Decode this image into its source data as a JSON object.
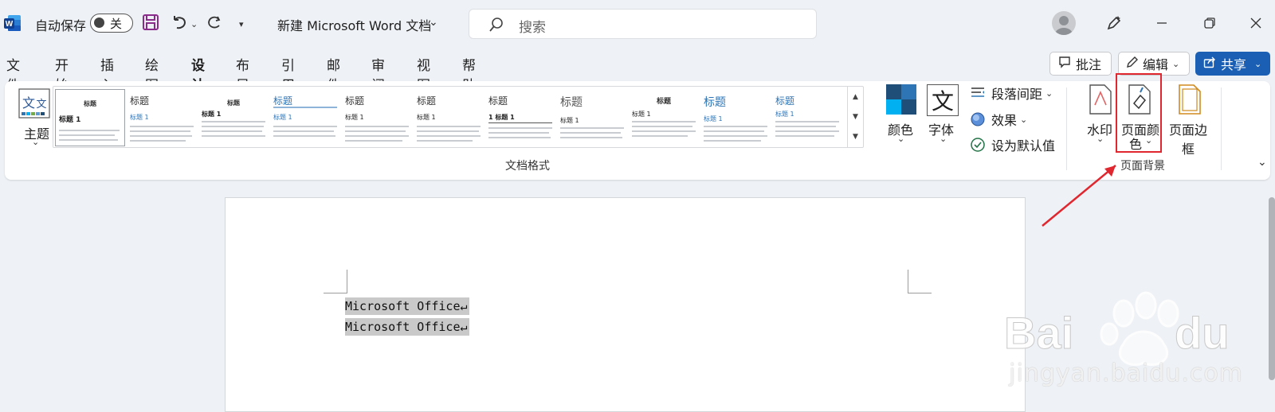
{
  "titlebar": {
    "autosave_label": "自动保存",
    "autosave_state": "关",
    "doc_title": "新建 Microsoft Word 文档",
    "search_placeholder": "搜索"
  },
  "tabs": [
    {
      "label": "文件"
    },
    {
      "label": "开始"
    },
    {
      "label": "插入"
    },
    {
      "label": "绘图"
    },
    {
      "label": "设计"
    },
    {
      "label": "布局"
    },
    {
      "label": "引用"
    },
    {
      "label": "邮件"
    },
    {
      "label": "审阅"
    },
    {
      "label": "视图"
    },
    {
      "label": "帮助"
    }
  ],
  "active_tab": "设计",
  "actions": {
    "comments": "批注",
    "edit": "编辑",
    "share": "共享"
  },
  "ribbon": {
    "theme": "主题",
    "styles": [
      {
        "title": "标题",
        "heading": "标题 1"
      },
      {
        "title": "标题",
        "heading": "标题 1"
      },
      {
        "title": "标题",
        "heading": "标题 1"
      },
      {
        "title": "标题",
        "heading": "标题 1"
      },
      {
        "title": "标题",
        "heading": "标题 1"
      },
      {
        "title": "标题",
        "heading": "标题 1"
      },
      {
        "title": "标题",
        "heading": "1 标题 1"
      },
      {
        "title": "标题",
        "heading": "标题 1"
      },
      {
        "title": "标题",
        "heading": "标题 1"
      },
      {
        "title": "标题",
        "heading": "标题 1"
      },
      {
        "title": "标题",
        "heading": "标题 1"
      }
    ],
    "group_doc_format": "文档格式",
    "colors": "颜色",
    "fonts": "字体",
    "font_glyph": "文",
    "paragraph_spacing": "段落间距",
    "effects": "效果",
    "set_default": "设为默认值",
    "watermark": "水印",
    "page_color_line1": "页面颜",
    "page_color_line2": "色",
    "page_borders": "页面边框",
    "group_page_background": "页面背景"
  },
  "document": {
    "lines": [
      "Microsoft Office↵",
      "Microsoft Office↵"
    ]
  },
  "watermark_text": "jingyan.baidu.com",
  "colors": {
    "accent": "#185abd",
    "share_bg": "#1a5fb4",
    "highlight": "#e0262e"
  }
}
